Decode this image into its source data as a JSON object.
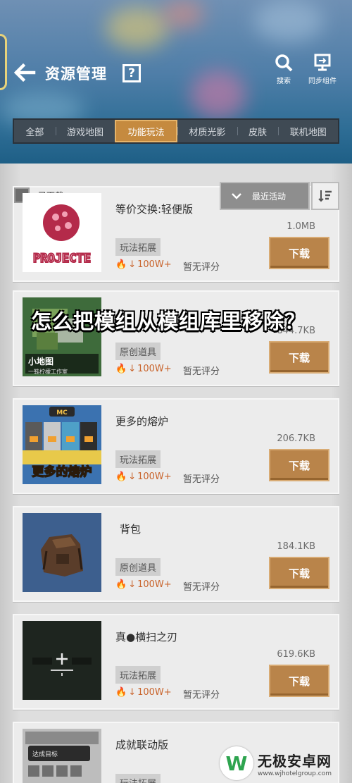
{
  "header": {
    "title": "资源管理",
    "help_glyph": "?",
    "search_label": "搜索",
    "sync_label": "同步组件"
  },
  "tabs": [
    {
      "label": "全部",
      "active": false
    },
    {
      "label": "游戏地图",
      "active": false
    },
    {
      "label": "功能玩法",
      "active": true
    },
    {
      "label": "材质光影",
      "active": false
    },
    {
      "label": "皮肤",
      "active": false
    },
    {
      "label": "联机地图",
      "active": false
    }
  ],
  "sort": {
    "label": "最近活动"
  },
  "downloaded_label": "已下载",
  "overlay_text": "怎么把模组从模组库里移除？",
  "items": [
    {
      "name": "等价交换:轻便版",
      "size": "1.0MB",
      "tag": "玩法拓展",
      "downloads": "100W+",
      "rating": "暂无评分",
      "button": "下载",
      "thumb_text": "PROJECTE"
    },
    {
      "name": "",
      "size": "844.7KB",
      "tag": "原创道具",
      "downloads": "100W+",
      "rating": "暂无评分",
      "button": "下载",
      "thumb_text": "小地图",
      "thumb_sub": "一鞋柠檬工作室"
    },
    {
      "name": "更多的熔炉",
      "size": "206.7KB",
      "tag": "玩法拓展",
      "downloads": "100W+",
      "rating": "暂无评分",
      "button": "下载",
      "thumb_text": "更多的熔炉",
      "thumb_badge": "MC"
    },
    {
      "name": "背包",
      "size": "184.1KB",
      "tag": "原创道具",
      "downloads": "100W+",
      "rating": "暂无评分",
      "button": "下载"
    },
    {
      "name": "真●横扫之刃",
      "size": "619.6KB",
      "tag": "玩法拓展",
      "downloads": "100W+",
      "rating": "暂无评分",
      "button": "下载"
    },
    {
      "name": "成就联动版",
      "tag": "玩法拓展",
      "thumb_text": "达成目标"
    }
  ],
  "watermark": {
    "title": "无极安卓网",
    "url": "www.wjhotelgroup.com"
  }
}
